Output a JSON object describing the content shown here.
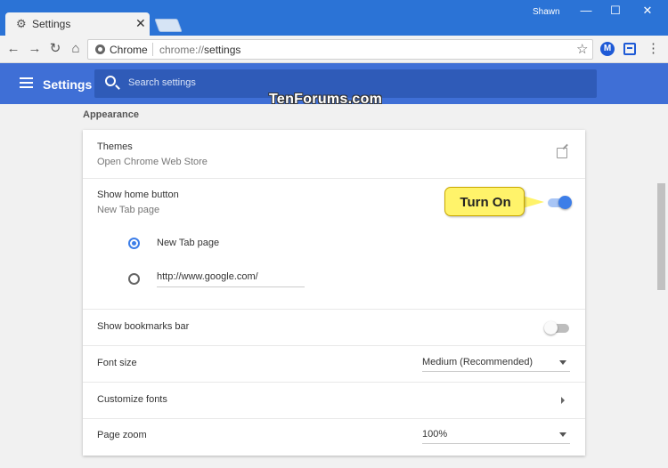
{
  "window": {
    "tab_title": "Settings",
    "tab_close": "✕",
    "user_name": "Shawn",
    "minimize": "—",
    "maximize": "☐",
    "close": "✕"
  },
  "toolbar": {
    "back": "←",
    "forward": "→",
    "reload": "↻",
    "home": "⌂",
    "site_label": "Chrome",
    "url_scheme": "chrome://",
    "url_path": "settings",
    "star": "☆",
    "ext1_label": "M",
    "menu": "⋮"
  },
  "header": {
    "title": "Settings",
    "search_placeholder": "Search settings"
  },
  "watermark": "TenForums.com",
  "appearance": {
    "section_title": "Appearance",
    "themes_label": "Themes",
    "themes_sub": "Open Chrome Web Store",
    "home_button_label": "Show home button",
    "home_button_sub": "New Tab page",
    "home_button_on": true,
    "radio_new_tab": "New Tab page",
    "radio_custom_url": "http://www.google.com/",
    "bookmarks_label": "Show bookmarks bar",
    "bookmarks_on": false,
    "font_size_label": "Font size",
    "font_size_value": "Medium (Recommended)",
    "customize_fonts_label": "Customize fonts",
    "page_zoom_label": "Page zoom",
    "page_zoom_value": "100%"
  },
  "callout": {
    "text": "Turn On"
  },
  "colors": {
    "titlebar": "#2b73d6",
    "header": "#3f6fd6",
    "accent": "#3d7ee8",
    "callout": "#fff36a"
  }
}
